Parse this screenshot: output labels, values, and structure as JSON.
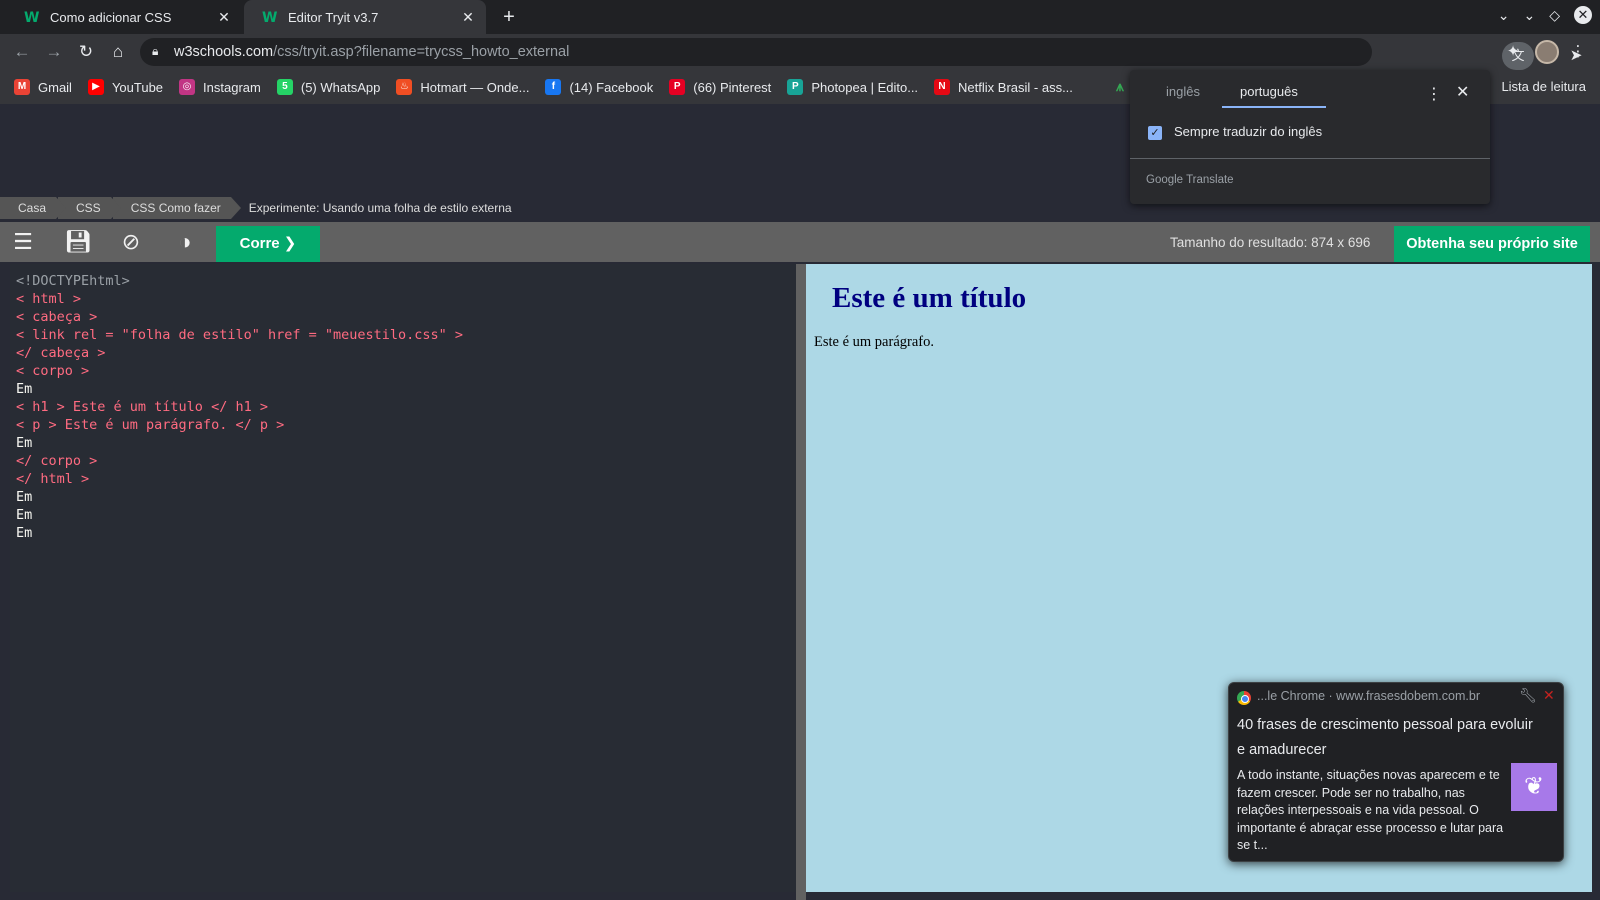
{
  "tabs": [
    {
      "title": "Como adicionar CSS",
      "favicon": "w3schools-icon",
      "active": false
    },
    {
      "title": "Editor Tryit v3.7",
      "favicon": "w3schools-icon",
      "active": true
    }
  ],
  "address": {
    "host": "w3schools.com",
    "path": "/css/tryit.asp?filename=trycss_howto_external"
  },
  "bookmarks": [
    {
      "label": "Gmail",
      "icon": "gmail-icon",
      "color": "#ea4335",
      "glyph": "M"
    },
    {
      "label": "YouTube",
      "icon": "youtube-icon",
      "color": "#ff0000",
      "glyph": "▶"
    },
    {
      "label": "Instagram",
      "icon": "instagram-icon",
      "color": "#c13584",
      "glyph": "◎"
    },
    {
      "label": "(5) WhatsApp",
      "icon": "whatsapp-icon",
      "color": "#25d366",
      "glyph": "5"
    },
    {
      "label": "Hotmart — Onde...",
      "icon": "hotmart-icon",
      "color": "#f04e23",
      "glyph": "♨"
    },
    {
      "label": "(14) Facebook",
      "icon": "facebook-icon",
      "color": "#1877f2",
      "glyph": "f"
    },
    {
      "label": "(66) Pinterest",
      "icon": "pinterest-icon",
      "color": "#e60023",
      "glyph": "P"
    },
    {
      "label": "Photopea | Edito...",
      "icon": "photopea-icon",
      "color": "#18a497",
      "glyph": "P"
    },
    {
      "label": "Netflix Brasil - ass...",
      "icon": "netflix-icon",
      "color": "#e50914",
      "glyph": "N"
    }
  ],
  "reading_list": "Lista de leitura",
  "breadcrumbs": [
    "Casa",
    "CSS",
    "CSS Como fazer"
  ],
  "breadcrumb_current": "Experimente: Usando uma folha de estilo externa",
  "editor_toolbar": {
    "run_label": "Corre ❯",
    "result_size": "Tamanho do resultado: 874 x 696",
    "get_site_label": "Obtenha seu próprio site"
  },
  "code_lines": [
    "<!DOCTYPEhtml>",
    "< html >",
    "< cabeça >",
    "< link rel = \"folha de estilo\" href = \"meuestilo.css\" >",
    "</ cabeça >",
    "< corpo >",
    "Em",
    "< h1 > Este é um título </ h1 >",
    "< p > Este é um parágrafo. </ p >",
    "Em",
    "</ corpo >",
    "</ html >",
    "Em",
    "Em",
    "Em"
  ],
  "result": {
    "heading": "Este é um título",
    "paragraph": "Este é um parágrafo."
  },
  "translate_popup": {
    "tab_source": "inglês",
    "tab_target": "português",
    "checkbox_label": "Sempre traduzir do inglês",
    "checkbox_checked": true,
    "brand": "Google Translate"
  },
  "notification": {
    "source": "...le Chrome · www.frasesdobem.com.br",
    "title": "40 frases de crescimento pessoal para evoluir e amadurecer",
    "body": "A todo instante, situações novas aparecem e te fazem crescer. Pode ser no trabalho, nas relações interpessoais e na vida pessoal. O importante é abraçar esse processo e lutar para se t..."
  }
}
